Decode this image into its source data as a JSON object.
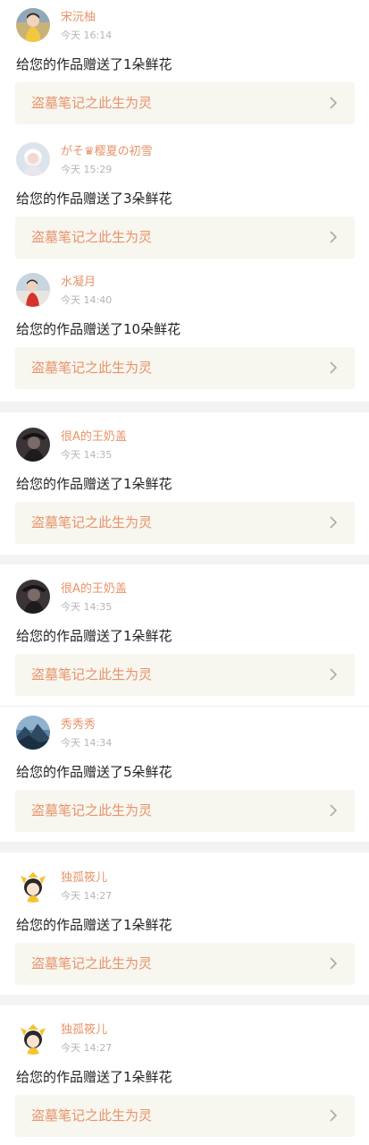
{
  "notifications": [
    {
      "name": "宋沅柚",
      "time": "今天 16:14",
      "message": "给您的作品赠送了1朵鲜花",
      "work": "盗墓笔记之此生为灵",
      "avatar": "avatar-girl-yellow-dress"
    },
    {
      "name": "がそ♛樱夏の初雪",
      "time": "今天 15:29",
      "message": "给您的作品赠送了3朵鲜花",
      "work": "盗墓笔记之此生为灵",
      "avatar": "avatar-girl-white-hair"
    },
    {
      "name": "水凝月",
      "time": "今天 14:40",
      "message": "给您的作品赠送了10朵鲜花",
      "work": "盗墓笔记之此生为灵",
      "avatar": "avatar-girl-red-outfit"
    },
    {
      "name": "很A的王奶盖",
      "time": "今天 14:35",
      "message": "给您的作品赠送了1朵鲜花",
      "work": "盗墓笔记之此生为灵",
      "avatar": "avatar-dark-hat"
    },
    {
      "name": "很A的王奶盖",
      "time": "今天 14:35",
      "message": "给您的作品赠送了1朵鲜花",
      "work": "盗墓笔记之此生为灵",
      "avatar": "avatar-dark-hat"
    },
    {
      "name": "秀秀秀",
      "time": "今天 14:34",
      "message": "给您的作品赠送了5朵鲜花",
      "work": "盗墓笔记之此生为灵",
      "avatar": "avatar-mountain"
    },
    {
      "name": "独孤筱儿",
      "time": "今天 14:27",
      "message": "给您的作品赠送了1朵鲜花",
      "work": "盗墓笔记之此生为灵",
      "avatar": "avatar-cartoon-girl"
    },
    {
      "name": "独孤筱儿",
      "time": "今天 14:27",
      "message": "给您的作品赠送了1朵鲜花",
      "work": "盗墓笔记之此生为灵",
      "avatar": "avatar-cartoon-girl"
    }
  ],
  "colors": {
    "accent": "#e8936a",
    "time": "#b5b5b5",
    "link_bg": "#f7f6ef",
    "separator": "#f3f3f3"
  }
}
